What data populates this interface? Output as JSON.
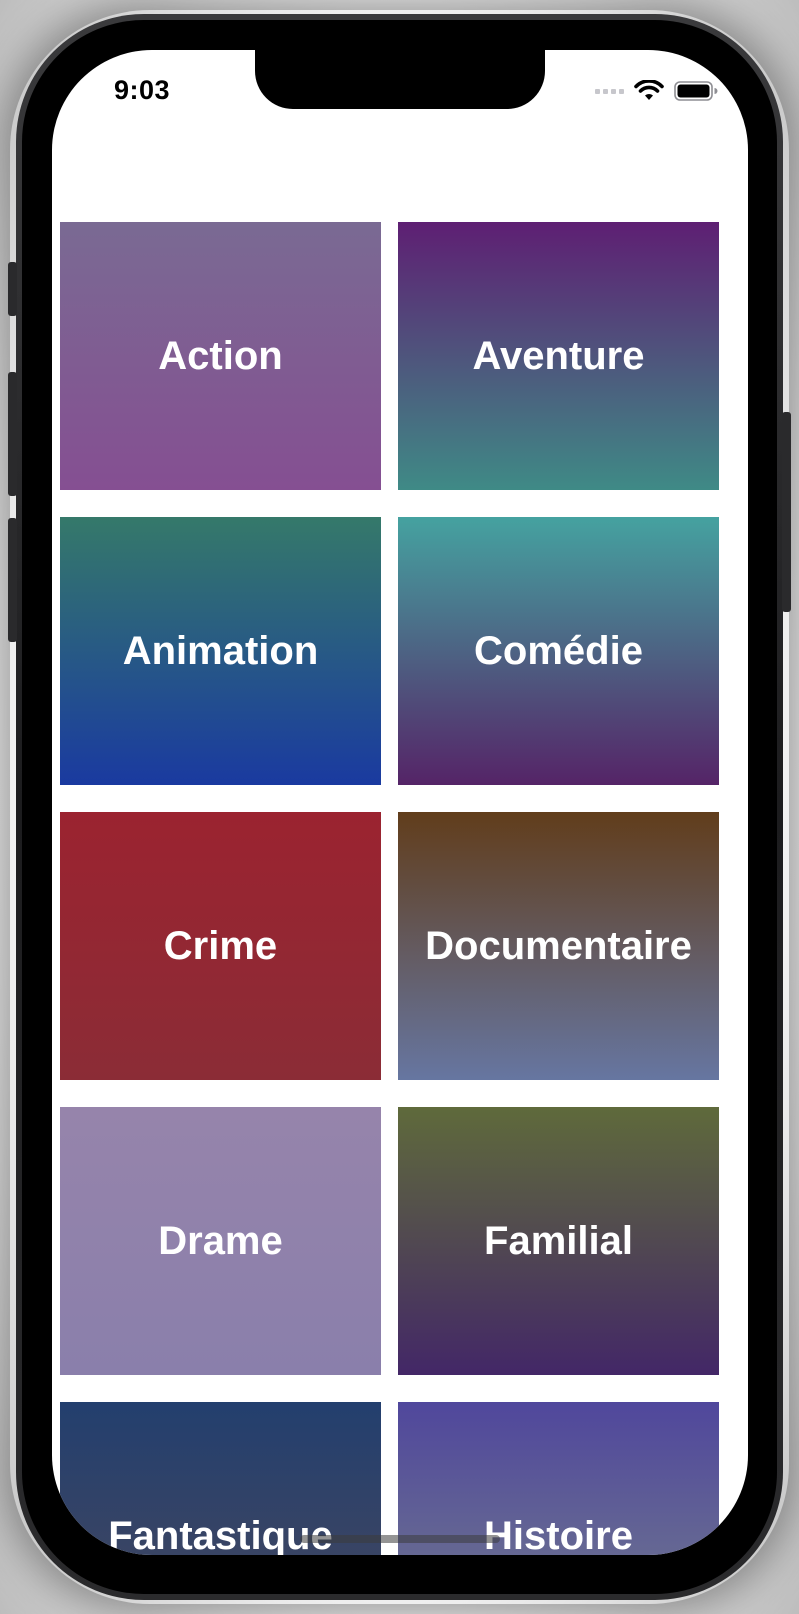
{
  "status_bar": {
    "time": "9:03"
  },
  "icons": {
    "wifi": "wifi-icon",
    "battery": "battery-icon",
    "signal": "cellular-signal-icon"
  },
  "genres": [
    {
      "label": "Action",
      "colors": [
        "#7a6a93",
        "#854f92"
      ]
    },
    {
      "label": "Aventure",
      "colors": [
        "#5e1f73",
        "#3f8a86"
      ]
    },
    {
      "label": "Animation",
      "colors": [
        "#35796a",
        "#1a3aa0"
      ]
    },
    {
      "label": "Comédie",
      "colors": [
        "#45a2a0",
        "#552467"
      ]
    },
    {
      "label": "Crime",
      "colors": [
        "#9b2330",
        "#8b2c36"
      ]
    },
    {
      "label": "Documentaire",
      "colors": [
        "#613d1b",
        "#6676a1"
      ]
    },
    {
      "label": "Drame",
      "colors": [
        "#9684ab",
        "#8a7fab"
      ]
    },
    {
      "label": "Familial",
      "colors": [
        "#5f6a3b",
        "#432767"
      ]
    },
    {
      "label": "Fantastique",
      "colors": [
        "#233f6e",
        "#49485d"
      ]
    },
    {
      "label": "Histoire",
      "colors": [
        "#50479c",
        "#75808c"
      ]
    }
  ]
}
